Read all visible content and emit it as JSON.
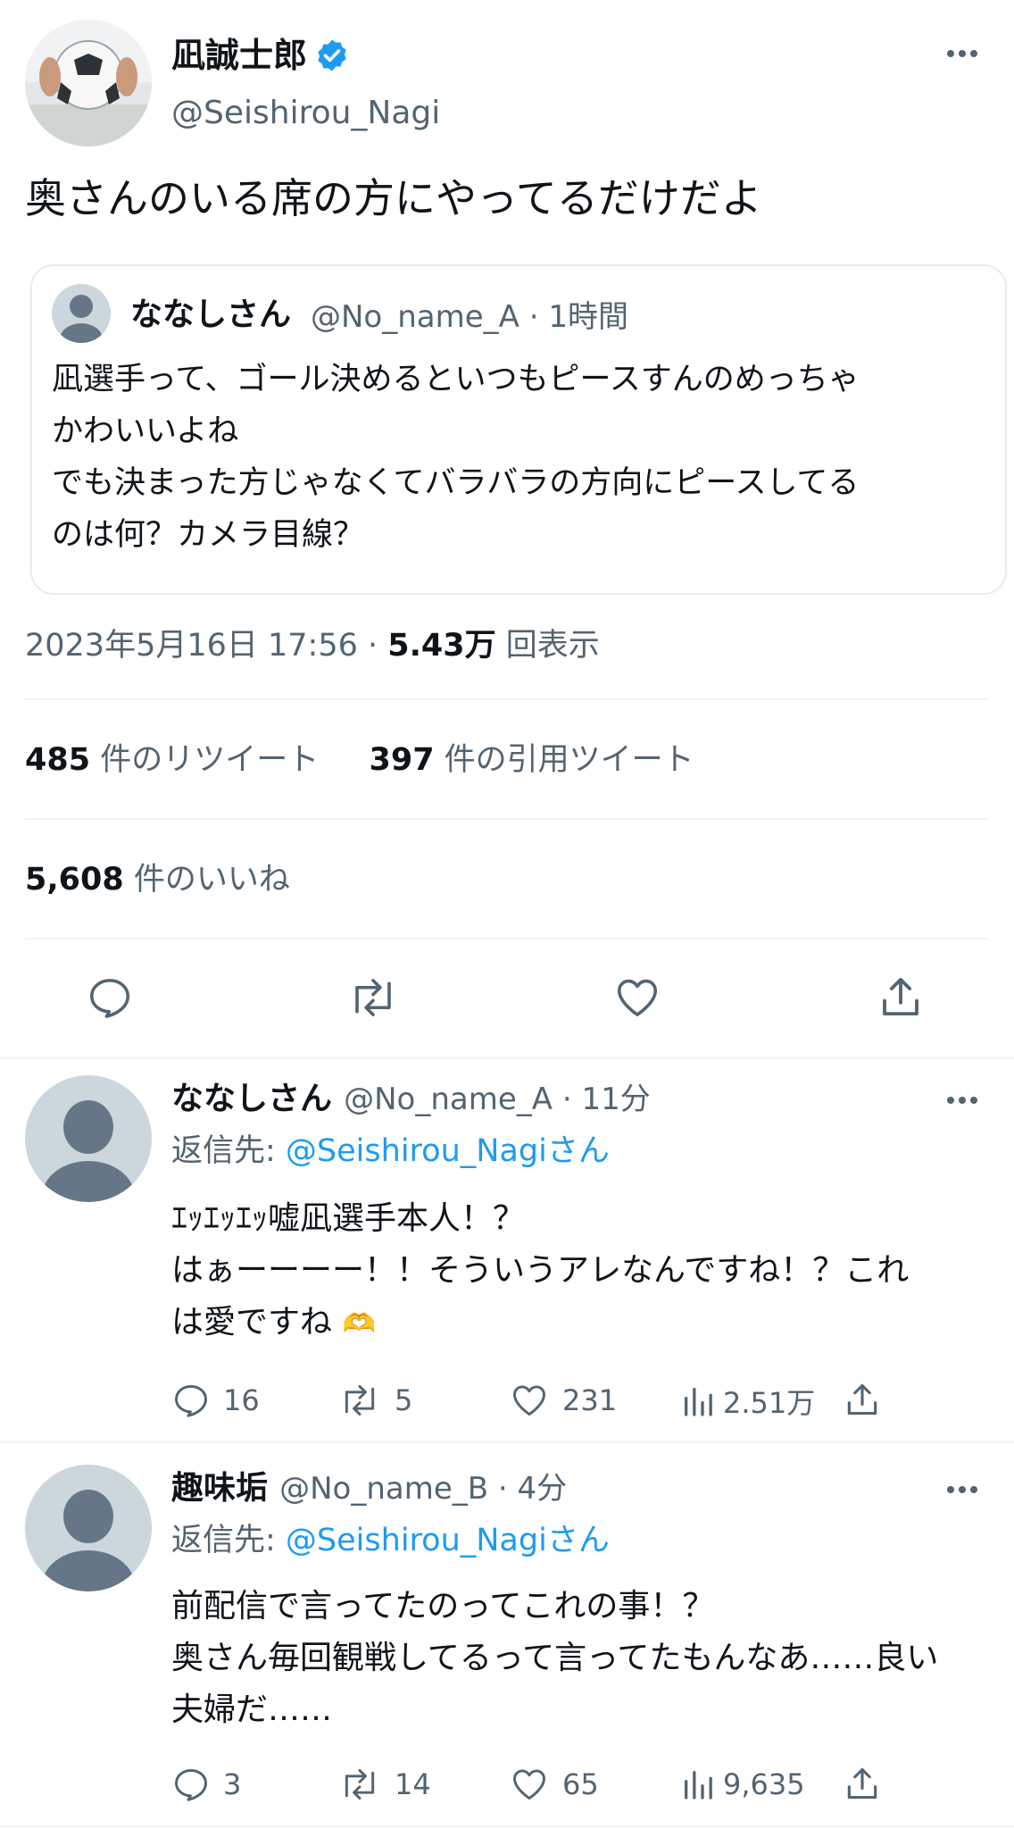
{
  "main_tweet": {
    "display_name": "凪誠士郎",
    "handle": "@Seishirou_Nagi",
    "text": "奥さんのいる席の方にやってるだけだよ",
    "quoted": {
      "name": "ななしさん",
      "handle_time": "@No_name_A · 1時間",
      "lines": [
        "凪選手って、ゴール決めるといつもピースすんのめっちゃ",
        "かわいいよね",
        "でも決まった方じゃなくてバラバラの方向にピースしてる",
        "のは何？カメラ目線？"
      ]
    },
    "timestamp": "2023年5月16日 17:56 · ",
    "views_count": "5.43万",
    "views_label": " 回表示",
    "retweets_count": "485",
    "retweets_label": " 件のリツイート",
    "quotes_count": "397",
    "quotes_label": " 件の引用ツイート",
    "likes_count": "5,608",
    "likes_label": " 件のいいね"
  },
  "replies": [
    {
      "name": "ななしさん",
      "handle_time": "@No_name_A · 11分",
      "reply_to_prefix": "返信先: ",
      "reply_to": "@Seishirou_Nagiさん",
      "lines": [
        "ｴｯｴｯｴｯ嘘凪選手本人！？",
        "はぁーーーー！！そういうアレなんですね！？これ",
        "は愛ですね"
      ],
      "emoji": "🫶",
      "replies": "16",
      "retweets": "5",
      "likes": "231",
      "views": "2.51万"
    },
    {
      "name": "趣味垢",
      "handle_time": "@No_name_B · 4分",
      "reply_to_prefix": "返信先: ",
      "reply_to": "@Seishirou_Nagiさん",
      "lines": [
        "前配信で言ってたのってこれの事！？",
        "奥さん毎回観戦してるって言ってたもんなあ……良い",
        "夫婦だ……"
      ],
      "replies": "3",
      "retweets": "14",
      "likes": "65",
      "views": "9,635"
    }
  ],
  "colors": {
    "accent": "#1d9bf0",
    "text": "#0f1419",
    "muted": "#536471",
    "divider": "#eff3f4"
  },
  "icons": [
    "verified-badge-icon",
    "more-icon",
    "reply-icon",
    "retweet-icon",
    "like-icon",
    "share-icon",
    "views-icon",
    "default-avatar-icon"
  ]
}
